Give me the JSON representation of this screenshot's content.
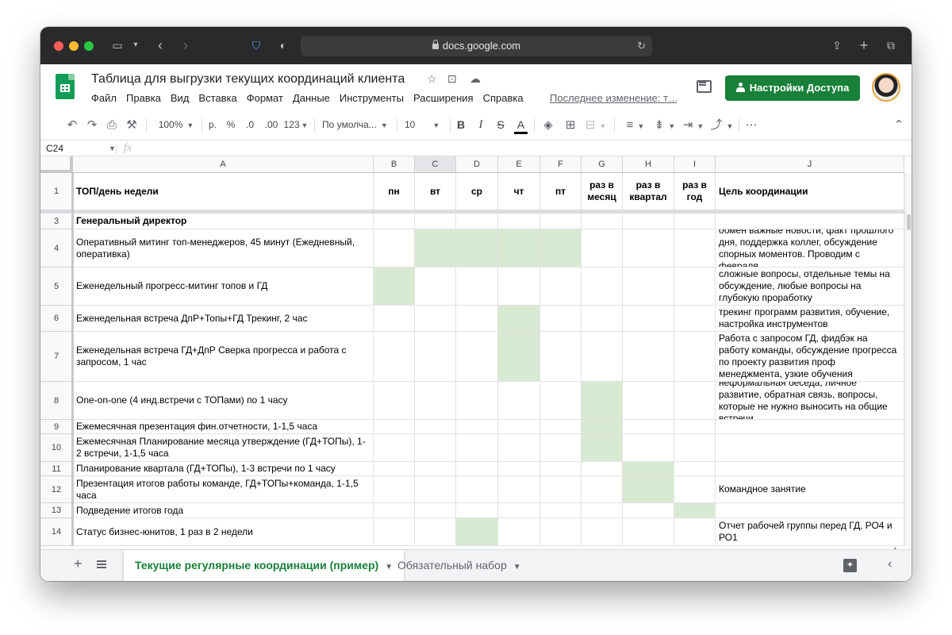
{
  "browser": {
    "url": "docs.google.com"
  },
  "doc": {
    "title": "Таблица для выгрузки текущих координаций клиента",
    "menu": [
      "Файл",
      "Правка",
      "Вид",
      "Вставка",
      "Формат",
      "Данные",
      "Инструменты",
      "Расширения",
      "Справка"
    ],
    "last_edit": "Последнее изменение: т…",
    "share_label": "Настройки Доступа"
  },
  "toolbar": {
    "zoom": "100%",
    "currency": "р.",
    "percent": "%",
    "dec_less": ".0",
    "dec_more": ".00",
    "number_format": "123",
    "font": "По умолча...",
    "font_size": "10",
    "bold": "B",
    "italic": "I",
    "strike": "S",
    "text_color": "A"
  },
  "formula_bar": {
    "cell_ref": "C24",
    "fx": "fx"
  },
  "colors": {
    "accent_green": "#188038",
    "cell_green": "#d9ead3"
  },
  "sheet": {
    "columns": [
      "A",
      "B",
      "C",
      "D",
      "E",
      "F",
      "G",
      "H",
      "I",
      "J"
    ],
    "selected_column": "C",
    "header_row": {
      "num": "1",
      "a": "ТОП/день недели",
      "b": "пн",
      "c": "вт",
      "d": "ср",
      "e": "чт",
      "f": "пт",
      "g": "раз в месяц",
      "h": "раз в квартал",
      "i": "раз в год",
      "j": "Цель координации"
    },
    "section_row": {
      "num": "3",
      "a": "Генеральный директор"
    },
    "rows": [
      {
        "num": "4",
        "a": "Оперативный митинг топ-менеджеров, 45 минут (Ежедневный, оперативка)",
        "j": "обмен важные новости, факт прошлого дня, поддержка коллег, обсуждение спорных моментов. Проводим с февраля",
        "green": [
          "C",
          "D",
          "E",
          "F"
        ]
      },
      {
        "num": "5",
        "a": "Еженедельный прогресс-митинг топов и ГД",
        "j": "сложные вопросы, отдельные темы на обсуждение, любые вопросы на глубокую проработку",
        "green": [
          "B"
        ]
      },
      {
        "num": "6",
        "a": "Еженедельная встреча ДпР+Топы+ГД Трекинг, 2 час",
        "j": "трекинг программ развития, обучение, настройка инструментов",
        "green": [
          "E"
        ]
      },
      {
        "num": "7",
        "a": "Еженедельная встреча ГД+ДпР Сверка прогресса и работа с запросом, 1 час",
        "j": "Работа с запросом ГД, фидбэк на работу команды, обсуждение прогресса по проекту развития проф менеджмента, узкие обучения",
        "green": [
          "E"
        ]
      },
      {
        "num": "8",
        "a": "One-on-one (4 инд.встречи с ТОПами) по 1 часу",
        "j": "неформальная беседа, личное развитие, обратная связь, вопросы, которые не нужно выносить на общие встречи",
        "green": [
          "G"
        ]
      },
      {
        "num": "9",
        "a": "Ежемесячная презентация фин.отчетности, 1-1,5 часа",
        "j": "",
        "green": [
          "G"
        ]
      },
      {
        "num": "10",
        "a": "Ежемесячная Планирование месяца утверждение (ГД+ТОПы), 1-2 встречи, 1-1,5 часа",
        "j": "",
        "green": [
          "G"
        ]
      },
      {
        "num": "11",
        "a": "Планирование квартала (ГД+ТОПы), 1-3 встречи по 1 часу",
        "j": "",
        "green": [
          "H"
        ]
      },
      {
        "num": "12",
        "a": "Презентация итогов работы команде, ГД+ТОПы+команда, 1-1,5 часа",
        "j": "Командное занятие",
        "green": [
          "H"
        ]
      },
      {
        "num": "13",
        "a": "Подведение итогов года",
        "j": "",
        "green": [
          "I"
        ]
      },
      {
        "num": "14",
        "a": "Статус бизнес-юнитов, 1 раз в 2 недели",
        "j": "Отчет рабочей группы перед ГД, РО4 и РО1",
        "green": [
          "D"
        ]
      }
    ]
  },
  "tabs": {
    "active": "Текущие регулярные координации (пример)",
    "inactive": "Обязательный набор"
  }
}
